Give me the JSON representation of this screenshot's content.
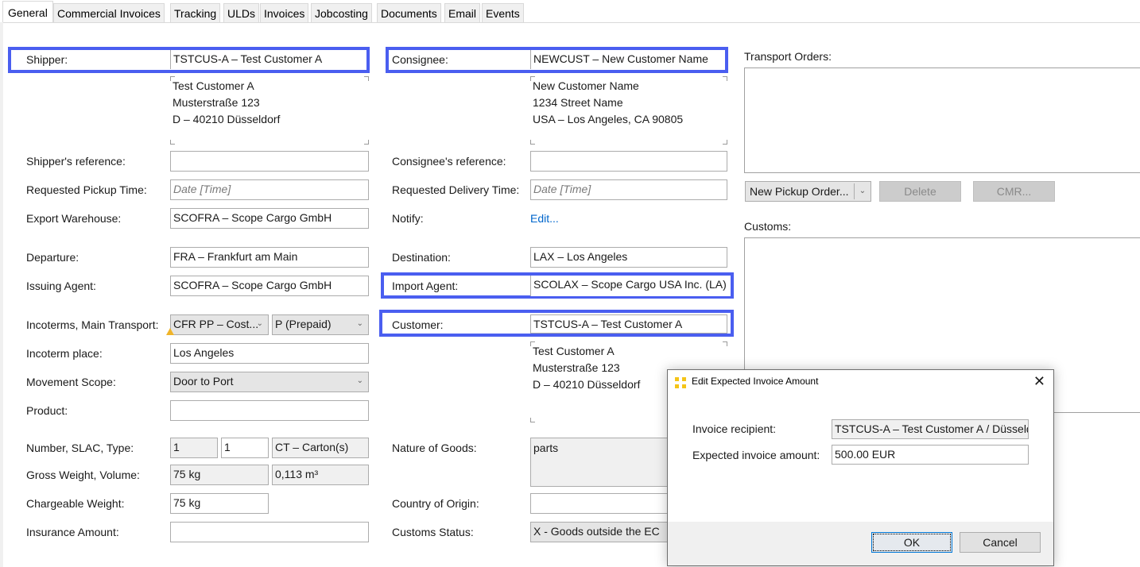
{
  "tabs": [
    {
      "label": "General",
      "active": true
    },
    {
      "label": "Commercial Invoices"
    },
    {
      "label": "Tracking"
    },
    {
      "label": "ULDs"
    },
    {
      "label": "Invoices"
    },
    {
      "label": "Jobcosting"
    },
    {
      "label": "Documents"
    },
    {
      "label": "Email"
    },
    {
      "label": "Events"
    }
  ],
  "left": {
    "shipper": {
      "label": "Shipper:",
      "value": "TSTCUS-A – Test Customer A",
      "address": [
        "Test Customer A",
        "Musterstraße 123",
        "D – 40210 Düsseldorf"
      ]
    },
    "shipper_ref": {
      "label": "Shipper's reference:",
      "value": ""
    },
    "pickup_time": {
      "label": "Requested Pickup Time:",
      "placeholder": "Date [Time]"
    },
    "export_warehouse": {
      "label": "Export Warehouse:",
      "value": "SCOFRA – Scope Cargo GmbH"
    },
    "departure": {
      "label": "Departure:",
      "value": "FRA – Frankfurt am Main"
    },
    "issuing_agent": {
      "label": "Issuing Agent:",
      "value": "SCOFRA – Scope Cargo GmbH"
    },
    "incoterms": {
      "label": "Incoterms, Main Transport:",
      "value": "CFR PP – Cost...",
      "transport": "P (Prepaid)"
    },
    "incoterm_place": {
      "label": "Incoterm place:",
      "value": "Los Angeles"
    },
    "movement_scope": {
      "label": "Movement Scope:",
      "value": "Door to Port"
    },
    "product": {
      "label": "Product:",
      "value": ""
    },
    "number_slac_type": {
      "label": "Number, SLAC, Type:",
      "number": "1",
      "slac": "1",
      "type": "CT – Carton(s)"
    },
    "gross_weight_volume": {
      "label": "Gross Weight, Volume:",
      "weight": "75 kg",
      "volume": "0,113 m³"
    },
    "chargeable_weight": {
      "label": "Chargeable Weight:",
      "value": "75 kg"
    },
    "insurance_amount": {
      "label": "Insurance Amount:",
      "value": ""
    }
  },
  "middle": {
    "consignee": {
      "label": "Consignee:",
      "value": "NEWCUST – New Customer Name",
      "address": [
        "New Customer Name",
        "1234 Street Name",
        "USA – Los Angeles, CA 90805"
      ]
    },
    "consignee_ref": {
      "label": "Consignee's reference:",
      "value": ""
    },
    "delivery_time": {
      "label": "Requested Delivery Time:",
      "placeholder": "Date [Time]"
    },
    "notify": {
      "label": "Notify:",
      "link": "Edit..."
    },
    "destination": {
      "label": "Destination:",
      "value": "LAX – Los Angeles"
    },
    "import_agent": {
      "label": "Import Agent:",
      "value": "SCOLAX – Scope Cargo USA Inc. (LA)"
    },
    "customer": {
      "label": "Customer:",
      "value": "TSTCUS-A – Test Customer A",
      "address": [
        "Test Customer A",
        "Musterstraße 123",
        "D – 40210 Düsseldorf"
      ]
    },
    "nature_of_goods": {
      "label": "Nature of Goods:",
      "value": "parts"
    },
    "country_of_origin": {
      "label": "Country of Origin:",
      "value": ""
    },
    "customs_status": {
      "label": "Customs Status:",
      "value": "X - Goods outside the EC"
    }
  },
  "right": {
    "transport_orders_label": "Transport Orders:",
    "new_pickup_order": "New Pickup Order...",
    "delete": "Delete",
    "cmr": "CMR...",
    "customs_label": "Customs:"
  },
  "dialog": {
    "title": "Edit Expected Invoice Amount",
    "invoice_recipient_label": "Invoice recipient:",
    "invoice_recipient_value": "TSTCUS-A – Test Customer A / Düsseldorf",
    "expected_amount_label": "Expected invoice amount:",
    "expected_amount_value": "500.00 EUR",
    "ok": "OK",
    "cancel": "Cancel"
  },
  "colors": {
    "highlight": "#4a5ef0",
    "link": "#0066cc",
    "icon_yellow": "#f5c518",
    "warning": "#f0b429"
  }
}
